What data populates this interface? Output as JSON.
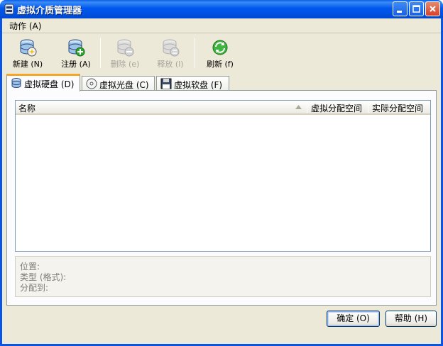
{
  "window": {
    "title": "虚拟介质管理器"
  },
  "menu": {
    "items": [
      {
        "label": "动作 (A)"
      }
    ]
  },
  "toolbar": {
    "new": "新建 (N)",
    "register": "注册 (A)",
    "delete": "删除 (e)",
    "release": "释放 (l)",
    "refresh": "刷新 (f)"
  },
  "tabs": [
    {
      "label": "虚拟硬盘 (D)",
      "active": true
    },
    {
      "label": "虚拟光盘 (C)",
      "active": false
    },
    {
      "label": "虚拟软盘 (F)",
      "active": false
    }
  ],
  "list": {
    "columns": [
      "名称",
      "虚拟分配空间",
      "实际分配空间"
    ],
    "rows": []
  },
  "info": {
    "location": "位置:",
    "type": "类型 (格式):",
    "attached": "分配到:"
  },
  "buttons": {
    "ok": "确定 (O)",
    "help": "帮助 (H)"
  },
  "colors": {
    "titlebar": "#0058ee",
    "window_bg": "#ece9d8",
    "tab_highlight": "#f5a623"
  }
}
